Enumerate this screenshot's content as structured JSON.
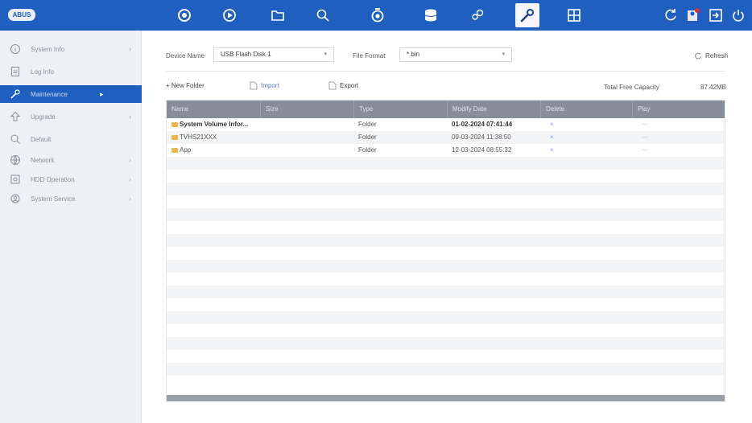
{
  "topbar": {
    "logo": "ABUS",
    "nav_icons": [
      "camera-icon",
      "play-icon",
      "folder-icon",
      "search-icon",
      "alarm-icon",
      "database-icon",
      "settings-icon",
      "wrench-icon",
      "grid-icon"
    ],
    "right_icons": [
      "refresh-icon",
      "user-icon",
      "logout-icon",
      "power-icon"
    ]
  },
  "sidebar": {
    "items": [
      {
        "label": "System Info",
        "icon": "info-icon",
        "chevron": "›"
      },
      {
        "label": "Log Info",
        "icon": "log-icon",
        "chevron": ""
      },
      {
        "label": "Maintenance",
        "icon": "maintenance-icon",
        "chevron": "▸"
      },
      {
        "label": "Upgrade",
        "icon": "upgrade-icon",
        "chevron": "›"
      },
      {
        "label": "Default",
        "icon": "default-icon",
        "chevron": ""
      },
      {
        "label": "Network",
        "icon": "network-icon",
        "chevron": "›"
      },
      {
        "label": "HDD Operation",
        "icon": "hdd-icon",
        "chevron": "›"
      },
      {
        "label": "System Service",
        "icon": "service-icon",
        "chevron": "›"
      }
    ]
  },
  "toolbar": {
    "device_name_label": "Device Name",
    "device_name_value": "USB Flash Disk 1",
    "file_format_label": "File Format",
    "file_format_value": "*.bin",
    "refresh_label": "Refresh",
    "new_folder_label": "+ New Folder",
    "import_label": "Import",
    "export_label": "Export",
    "free_capacity_label": "Total Free Capacity",
    "free_capacity_value": "87.42MB"
  },
  "table": {
    "columns": [
      "Name",
      "Size",
      "Type",
      "Modify Date",
      "Delete",
      "Play"
    ],
    "rows": [
      {
        "name": "System Volume Infor...",
        "size": "",
        "type": "Folder",
        "date": "01-02-2024 07:41:44",
        "delete": "×",
        "play": "—"
      },
      {
        "name": "TVHS21XXX",
        "size": "",
        "type": "Folder",
        "date": "09-03-2024 11:38:50",
        "delete": "×",
        "play": "—"
      },
      {
        "name": "App",
        "size": "",
        "type": "Folder",
        "date": "12-03-2024 08:55:32",
        "delete": "×",
        "play": "—"
      }
    ]
  },
  "colors": {
    "accent": "#1f5fbf",
    "header": "#888d99"
  }
}
